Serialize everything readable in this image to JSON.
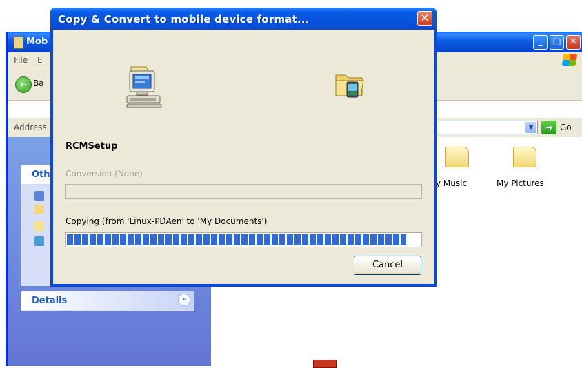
{
  "explorer": {
    "title": "Mob",
    "menu": [
      "File",
      "E"
    ],
    "back_label": "Ba",
    "address_label": "Address",
    "go_label": "Go",
    "sidebar": {
      "other_panel_title": "Oth",
      "details_panel_title": "Details"
    },
    "folders": [
      "y Music",
      "My Pictures"
    ]
  },
  "dialog": {
    "title": "Copy & Convert to mobile device format...",
    "file_name": "RCMSetup",
    "conversion_label": "Conversion (None)",
    "copying_label": "Copying (from 'Linux-PDAen' to 'My Documents')",
    "copy_progress": 0.96,
    "conversion_progress": 0,
    "cancel_label": "Cancel",
    "icons": [
      "computer-icon",
      "mobile-folder-icon",
      "close-icon"
    ]
  }
}
